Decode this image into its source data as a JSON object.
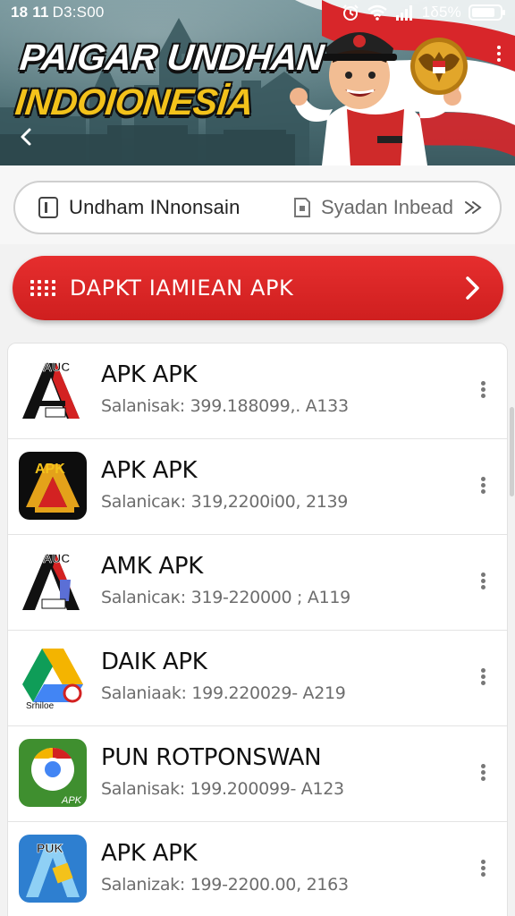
{
  "status_bar": {
    "time": "18 11",
    "time_suffix": "D3:S00",
    "battery_text": "1δ5%",
    "battery_level": 0.85,
    "icons": [
      "alarm-icon",
      "wifi-icon",
      "signal-icon",
      "battery-icon"
    ]
  },
  "banner": {
    "title_line1": "PAIGAR UNDHAN",
    "title_line2": "INDOIONESİA",
    "icons": [
      "back-icon",
      "more-vert-icon",
      "garuda-emblem-icon"
    ]
  },
  "search": {
    "left_label": "Undham  INnonsain",
    "right_label": "Syadan Inbead",
    "icons": [
      "document-icon",
      "file-icon",
      "arrow-right-icon"
    ]
  },
  "action": {
    "label": "DAPKT IAMIEAN APK",
    "color": "#e02626",
    "icons": [
      "grid-icon",
      "chevron-right-icon"
    ]
  },
  "apps": [
    {
      "name": "APK APK",
      "meta": "Salanisak: 399.188099,. A133",
      "icon": "auc-app-icon"
    },
    {
      "name": "APK APK",
      "meta": "Salaniсак: 319,2200і00, 2139",
      "icon": "apk-app-icon"
    },
    {
      "name": "AMK APK",
      "meta": "Salaniсак: 319-220000 ; A119",
      "icon": "auc-app-icon"
    },
    {
      "name": "DAIK APK",
      "meta": "Salaniaak: 199.220029- A219",
      "icon": "drive-app-icon"
    },
    {
      "name": "PUN ROTPONSWAN",
      "meta": "Salanisak: 199.200099- A123",
      "icon": "chrome-app-icon"
    },
    {
      "name": "APK APK",
      "meta": "Salanizak: 199-2200.00, 2163",
      "icon": "puk-app-icon"
    }
  ],
  "icon_labels": {
    "auc": "AUC",
    "apk": "APK",
    "puk": "PUK",
    "drive_caption": "Srhiloe",
    "chrome_caption": "APK"
  },
  "colors": {
    "accent_red": "#e02626",
    "banner_teal": "#4f7278",
    "title_yellow": "#f3c21b"
  }
}
